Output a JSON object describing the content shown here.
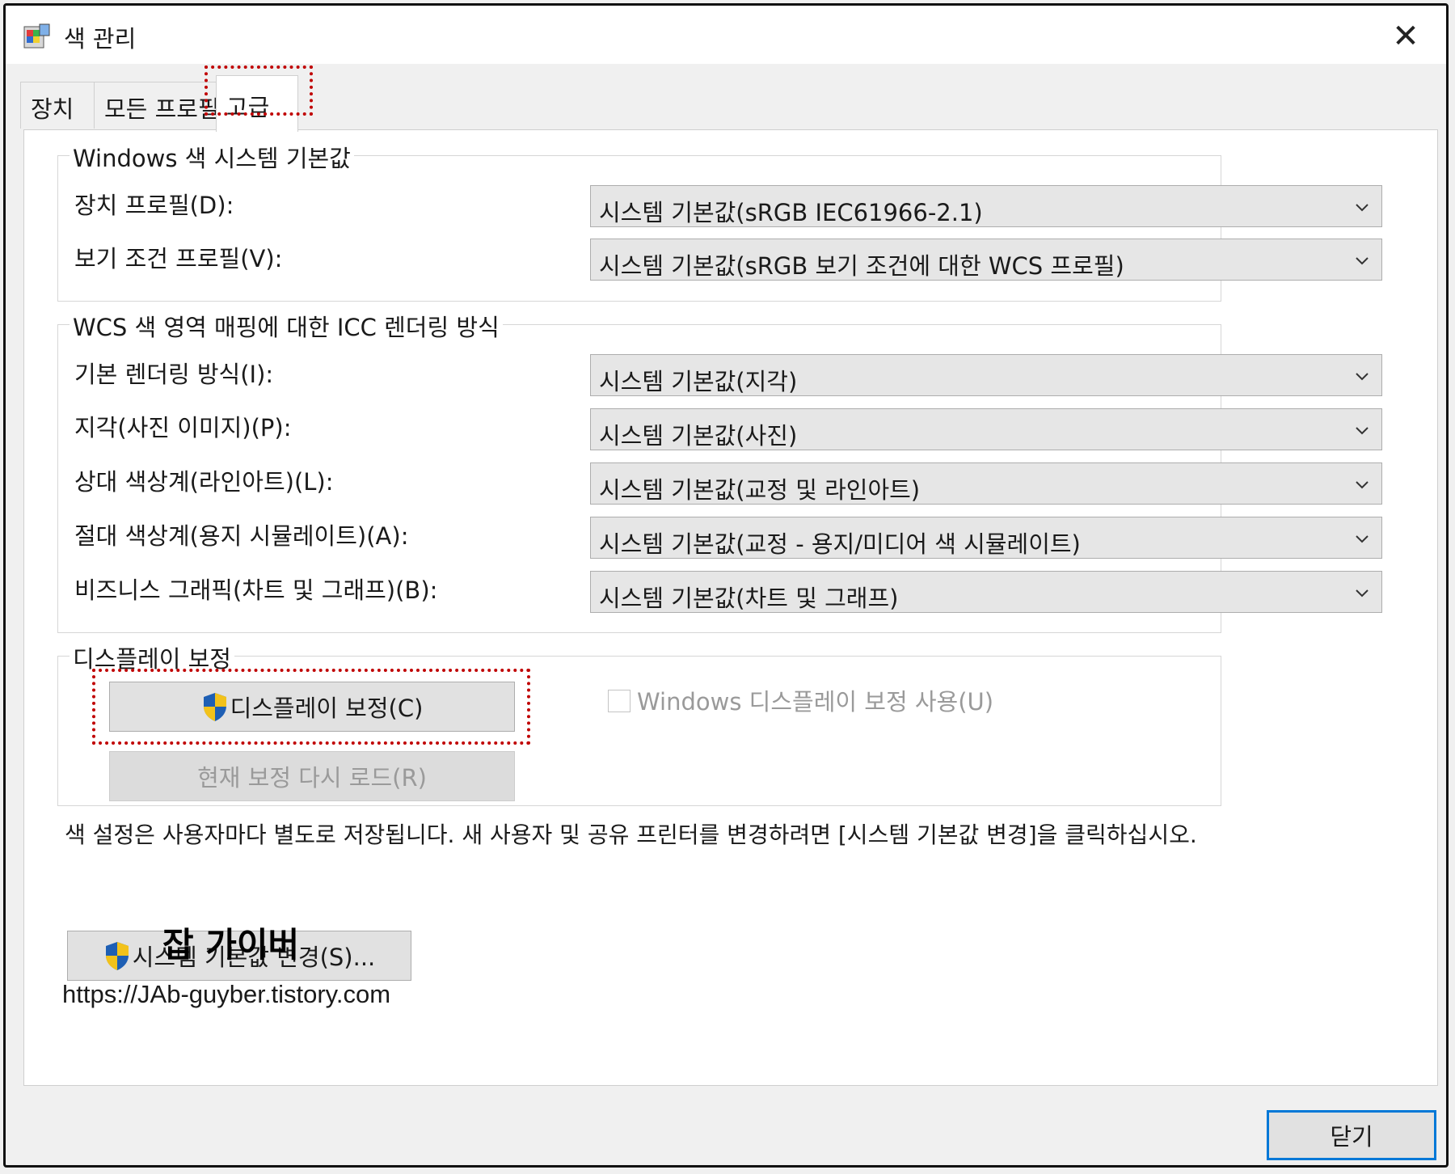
{
  "window": {
    "title": "색 관리",
    "close_glyph": "✕"
  },
  "tabs": [
    {
      "label": "장치"
    },
    {
      "label": "모든 프로필"
    },
    {
      "label": "고급"
    }
  ],
  "groups": {
    "windows_defaults": {
      "legend": "Windows 색 시스템 기본값",
      "rows": [
        {
          "label": "장치 프로필(D):",
          "value": "시스템 기본값(sRGB IEC61966-2.1)"
        },
        {
          "label": "보기 조건 프로필(V):",
          "value": "시스템 기본값(sRGB 보기 조건에 대한 WCS 프로필)"
        }
      ]
    },
    "icc_rendering": {
      "legend": "WCS 색 영역 매핑에 대한 ICC 렌더링 방식",
      "rows": [
        {
          "label": "기본 렌더링 방식(I):",
          "value": "시스템 기본값(지각)"
        },
        {
          "label": "지각(사진 이미지)(P):",
          "value": "시스템 기본값(사진)"
        },
        {
          "label": "상대 색상계(라인아트)(L):",
          "value": "시스템 기본값(교정 및 라인아트)"
        },
        {
          "label": "절대 색상계(용지 시뮬레이트)(A):",
          "value": "시스템 기본값(교정 - 용지/미디어 색 시뮬레이트)"
        },
        {
          "label": "비즈니스 그래픽(차트 및 그래프)(B):",
          "value": "시스템 기본값(차트 및 그래프)"
        }
      ]
    },
    "display_calibration": {
      "legend": "디스플레이 보정",
      "calibrate_button": "디스플레이 보정(C)",
      "reload_button": "현재 보정 다시 로드(R)",
      "checkbox_label": "Windows 디스플레이 보정 사용(U)",
      "checkbox_checked": false
    }
  },
  "info_text": "색 설정은 사용자마다 별도로 저장됩니다. 새 사용자 및 공유 프린터를 변경하려면 [시스템 기본값 변경]을 클릭하십시오.",
  "change_defaults_button": "시스템 기본값 변경(S)...",
  "watermark": "잡 가이버",
  "url": "https://JAb-guyber.tistory.com",
  "close_button": "닫기",
  "colors": {
    "highlight": "#c00000",
    "focus_border": "#0078d7",
    "shield_blue": "#1e5fb4",
    "shield_yellow": "#f2c21b"
  }
}
